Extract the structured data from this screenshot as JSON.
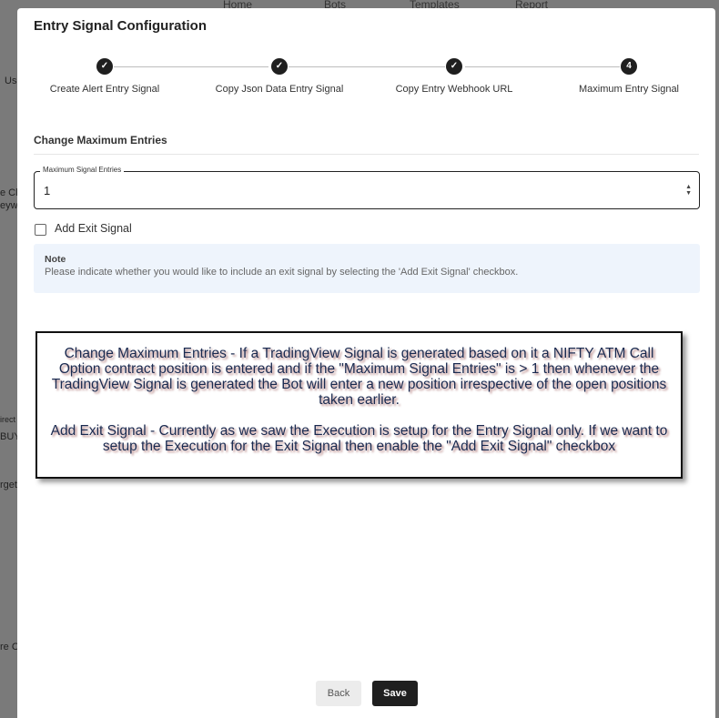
{
  "background": {
    "nav": [
      "Home",
      "Bots",
      "Templates",
      "Report"
    ],
    "fragments": [
      "Us",
      "e Cl",
      "eyw",
      "irect",
      "BUY",
      "rget",
      "re C"
    ]
  },
  "modal": {
    "title": "Entry Signal Configuration",
    "steps": [
      {
        "label": "Create Alert Entry Signal",
        "state": "done"
      },
      {
        "label": "Copy Json Data Entry Signal",
        "state": "done"
      },
      {
        "label": "Copy Entry Webhook URL",
        "state": "done"
      },
      {
        "label": "Maximum Entry Signal",
        "state": "active",
        "number": "4"
      }
    ],
    "section_title": "Change Maximum Entries",
    "max_entries": {
      "label": "Maximum Signal Entries",
      "value": "1"
    },
    "add_exit": {
      "label": "Add Exit Signal",
      "checked": false
    },
    "note": {
      "title": "Note",
      "text": "Please indicate whether you would like to include an exit signal by selecting the 'Add Exit Signal' checkbox."
    },
    "back_label": "Back",
    "save_label": "Save"
  },
  "callout": {
    "p1": "Change Maximum Entries - If a TradingView Signal is generated based on it a NIFTY ATM Call Option contract position is entered and if the \"Maximum Signal Entries\" is > 1 then whenever the TradingView Signal is generated the Bot will enter a new position irrespective of the open positions taken earlier.",
    "p2": "Add Exit Signal - Currently as we saw the Execution is setup for the Entry Signal only. If we want to setup the Execution for the Exit Signal then enable the \"Add Exit Signal\" checkbox"
  }
}
